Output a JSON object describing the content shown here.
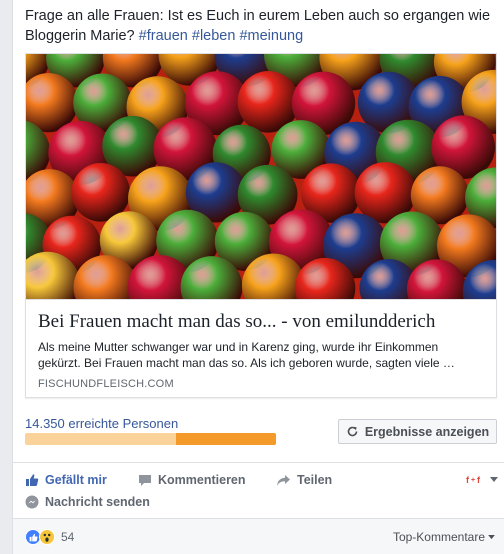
{
  "post": {
    "text_main": "Frage an alle Frauen: Ist es Euch in eurem Leben auch so ergangen wie Bloggerin Marie?",
    "hashtags": [
      "#frauen",
      "#leben",
      "#meinung"
    ]
  },
  "link_card": {
    "title": "Bei Frauen macht man das so... - von emilundderich",
    "description": "Als meine Mutter schwanger war und in Karenz ging, wurde ihr Einkommen gekürzt. Bei Frauen macht man das so. Als ich geboren wurde, sagten viele …",
    "domain": "FISCHUNDFLEISCH.COM"
  },
  "insights": {
    "reach_label": "14.350 erreichte Personen",
    "organic_fraction": 0.6,
    "paid_fraction": 0.4,
    "results_button": "Ergebnisse anzeigen",
    "colors": {
      "organic": "#fad39a",
      "paid": "#f39a2a"
    }
  },
  "actions": {
    "like": "Gefällt mir",
    "comment": "Kommentieren",
    "share": "Teilen",
    "send_message": "Nachricht senden"
  },
  "footer": {
    "reaction_icons": [
      "like-reaction-icon",
      "wow-reaction-icon"
    ],
    "reaction_count": "54",
    "sort_label": "Top-Kommentare"
  },
  "colors": {
    "link": "#365899",
    "accent": "#4267b2"
  }
}
